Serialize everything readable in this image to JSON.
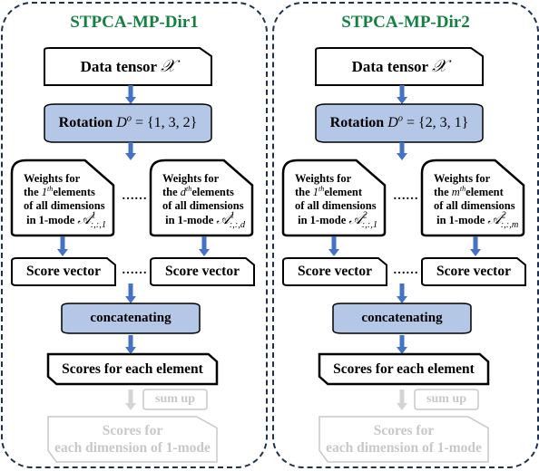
{
  "colors": {
    "title": "#138040",
    "accent_fill": "#b4c7e7",
    "arrow": "#4472c4",
    "muted": "#c8c8c8",
    "panel_border": "#1f3050"
  },
  "panels": [
    {
      "title": "STPCA-MP-Dir1",
      "data_tensor_label": "Data tensor",
      "data_tensor_symbol": "𝒳",
      "rotation_label": "Rotation",
      "rotation_var": "D",
      "rotation_sup": "o",
      "rotation_set": "= {1, 3, 2}",
      "weights": [
        {
          "line1": "Weights for",
          "the": "the",
          "ordinal": "1",
          "ordinal_sup": "th",
          "elem": "elements",
          "line3": "of all dimensions",
          "line4": "in 1-mode",
          "sym": "𝒜",
          "sym_sup": "1",
          "sym_sub": ":,:,1"
        },
        {
          "line1": "Weights for",
          "the": "the",
          "ordinal": "d",
          "ordinal_sup": "th",
          "elem": "elements",
          "line3": "of all dimensions",
          "line4": "in 1-mode",
          "sym": "𝒜",
          "sym_sup": "1",
          "sym_sub": ":,:,d"
        }
      ],
      "ellipsis": "……",
      "score_vector": "Score vector",
      "concatenating": "concatenating",
      "scores_element": "Scores for each element",
      "sum_up": "sum up",
      "scores_dimension_line1": "Scores for",
      "scores_dimension_line2": "each dimension of 1-mode"
    },
    {
      "title": "STPCA-MP-Dir2",
      "data_tensor_label": "Data tensor",
      "data_tensor_symbol": "𝒳",
      "rotation_label": "Rotation",
      "rotation_var": "D",
      "rotation_sup": "o",
      "rotation_set": "= {2, 3, 1}",
      "weights": [
        {
          "line1": "Weights for",
          "the": "the",
          "ordinal": "1",
          "ordinal_sup": "th",
          "elem": "element",
          "line3": "of all dimensions",
          "line4": "in 1-mode",
          "sym": "𝒜",
          "sym_sup": "2",
          "sym_sub": ":,:,1"
        },
        {
          "line1": "Weights for",
          "the": "the",
          "ordinal": "m",
          "ordinal_sup": "th",
          "elem": "element",
          "line3": "of all dimensions",
          "line4": "in 1-mode",
          "sym": "𝒜",
          "sym_sup": "2",
          "sym_sub": ":,:,m"
        }
      ],
      "ellipsis": "……",
      "score_vector": "Score vector",
      "concatenating": "concatenating",
      "scores_element": "Scores for each element",
      "sum_up": "sum up",
      "scores_dimension_line1": "Scores for",
      "scores_dimension_line2": "each dimension of 1-mode"
    }
  ]
}
